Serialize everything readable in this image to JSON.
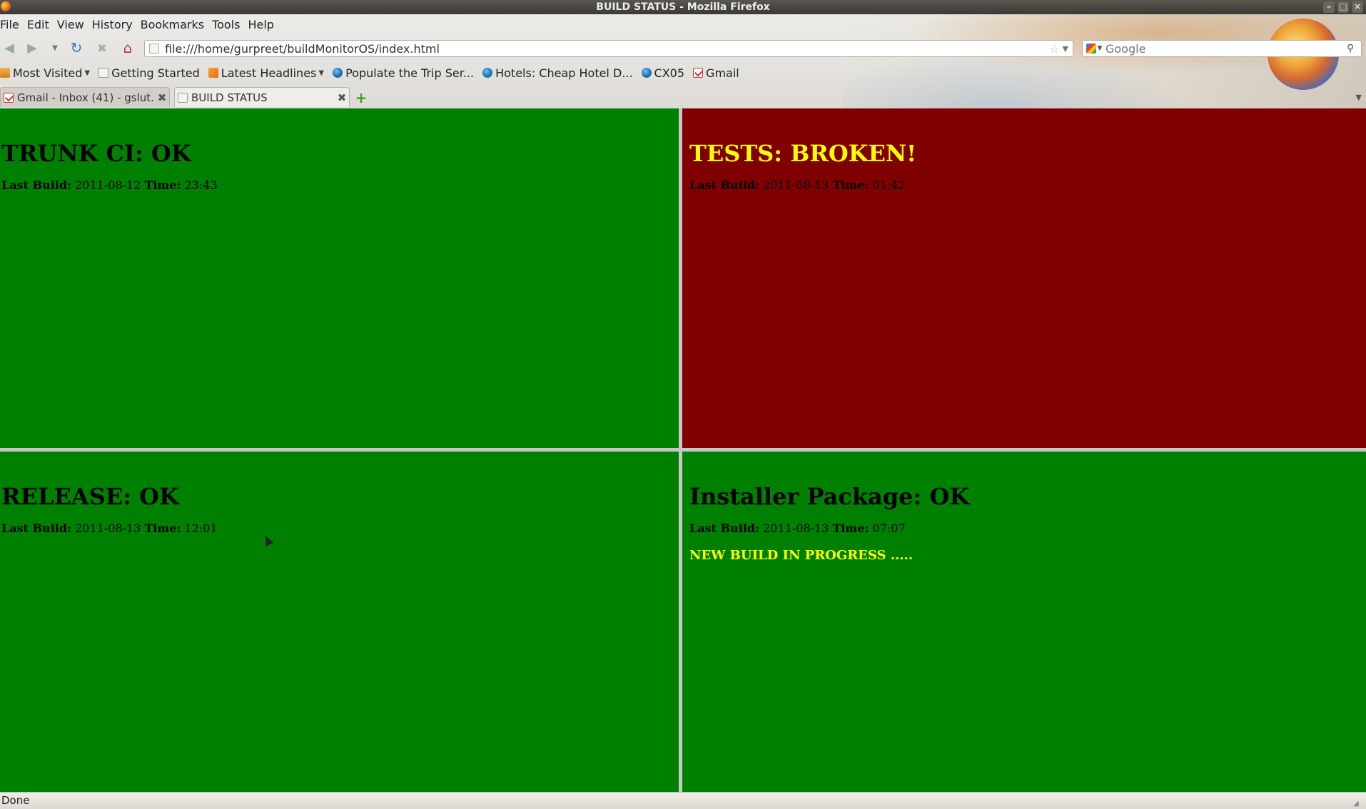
{
  "window": {
    "title": "BUILD STATUS - Mozilla Firefox"
  },
  "menubar": [
    "File",
    "Edit",
    "View",
    "History",
    "Bookmarks",
    "Tools",
    "Help"
  ],
  "navbar": {
    "url": "file:///home/gurpreet/buildMonitorOS/index.html",
    "search_placeholder": "Google"
  },
  "bookmarks": [
    {
      "label": "Most Visited",
      "icon": "folder-icon",
      "dropdown": true
    },
    {
      "label": "Getting Started",
      "icon": "page-icon",
      "dropdown": false
    },
    {
      "label": "Latest Headlines",
      "icon": "rss-icon",
      "dropdown": true
    },
    {
      "label": "Populate the Trip Ser...",
      "icon": "globe-icon",
      "dropdown": false
    },
    {
      "label": "Hotels: Cheap Hotel D...",
      "icon": "globe-icon",
      "dropdown": false
    },
    {
      "label": "CX05",
      "icon": "globe-icon",
      "dropdown": false
    },
    {
      "label": "Gmail",
      "icon": "gmail-icon",
      "dropdown": false
    }
  ],
  "tabs": [
    {
      "label": "Gmail - Inbox (41) - gslut...",
      "active": false
    },
    {
      "label": "BUILD STATUS",
      "active": true
    }
  ],
  "colors": {
    "ok": "#008000",
    "broken": "#800000",
    "alert_text": "#ffff00",
    "normal_text": "#000000"
  },
  "panels": {
    "trunk": {
      "title": "TRUNK CI: OK",
      "last_build_label": "Last Build:",
      "last_build_date": "2011-08-12",
      "time_label": "Time:",
      "time": "23:43",
      "status": "ok"
    },
    "tests": {
      "title": "TESTS: BROKEN!",
      "last_build_label": "Last Build:",
      "last_build_date": "2011-08-13",
      "time_label": "Time:",
      "time": "01:42",
      "status": "broken"
    },
    "release": {
      "title": "RELEASE: OK",
      "last_build_label": "Last Build:",
      "last_build_date": "2011-08-13",
      "time_label": "Time:",
      "time": "12:01",
      "status": "ok"
    },
    "installer": {
      "title": "Installer Package: OK",
      "last_build_label": "Last Build:",
      "last_build_date": "2011-08-13",
      "time_label": "Time:",
      "time": "07:07",
      "status": "ok",
      "progress_text": "NEW BUILD IN PROGRESS ....."
    }
  },
  "statusbar": {
    "text": "Done"
  }
}
